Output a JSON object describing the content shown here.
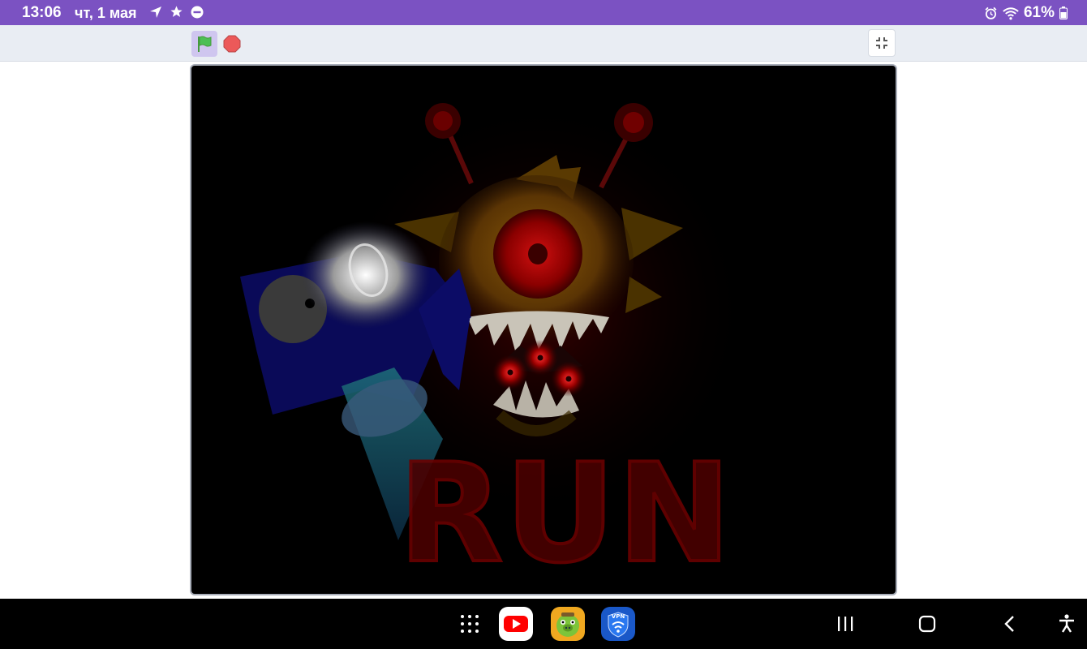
{
  "status_bar": {
    "time": "13:06",
    "date": "чт, 1 мая",
    "battery": "61%",
    "left_icons": [
      "navigation-arrow-icon",
      "star-icon",
      "do-not-disturb-icon"
    ],
    "right_icons": [
      "alarm-icon",
      "wifi-icon",
      "battery-icon"
    ],
    "background": "#7b52c2"
  },
  "player_controls": {
    "green_flag_icon": "green-flag-icon",
    "stop_icon": "stop-sign-icon",
    "fullscreen_icon": "exit-fullscreen-icon",
    "flag_color": "#4cbf56",
    "stop_color": "#ec5959"
  },
  "stage": {
    "title_text": "RUN",
    "background": "#000000",
    "text_color": "#5a0000"
  },
  "nav_bar": {
    "apps": [
      "app-drawer-icon",
      "youtube-icon",
      "bad-piggies-icon",
      "vpn-icon"
    ],
    "vpn_label": "VPN",
    "system_buttons": [
      "recents-icon",
      "home-icon",
      "back-icon",
      "accessibility-icon"
    ]
  }
}
